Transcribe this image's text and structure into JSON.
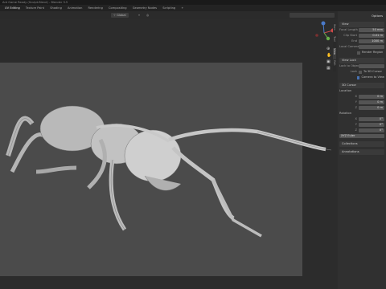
{
  "title": "Ant Game Ready (Sculpt-Blend) - Blender 3.5",
  "menu_tabs": [
    "UV Editing",
    "Texture Paint",
    "Shading",
    "Animation",
    "Rendering",
    "Compositing",
    "Geometry Nodes",
    "Scripting"
  ],
  "header": {
    "view_mode": "Global",
    "menu": "Options"
  },
  "npanel": {
    "tabs": [
      "Item",
      "Tool",
      "View",
      "Edit"
    ],
    "view_section": "View",
    "focal_label": "Focal Length",
    "focal_value": "50 mm",
    "clip_start_label": "Clip Start",
    "clip_start_value": "0.01 m",
    "clip_end_label": "End",
    "clip_end_value": "1000 m",
    "local_camera_label": "Local Camera",
    "render_region": "Render Region",
    "view_lock_section": "View Lock",
    "lock_to_object_label": "Lock to Object",
    "lock_label": "Lock",
    "to_3d_cursor": "To 3D Cursor",
    "camera_to_view": "Camera to View",
    "cursor_section": "3D Cursor",
    "location_label": "Location",
    "loc_x": "0 m",
    "loc_y": "0 m",
    "loc_z": "0 m",
    "rotation_label": "Rotation",
    "rot_x": "0°",
    "rot_y": "0°",
    "rot_z": "0°",
    "rotation_mode": "XYZ Euler",
    "collections_section": "Collections",
    "annotations_section": "Annotations"
  }
}
